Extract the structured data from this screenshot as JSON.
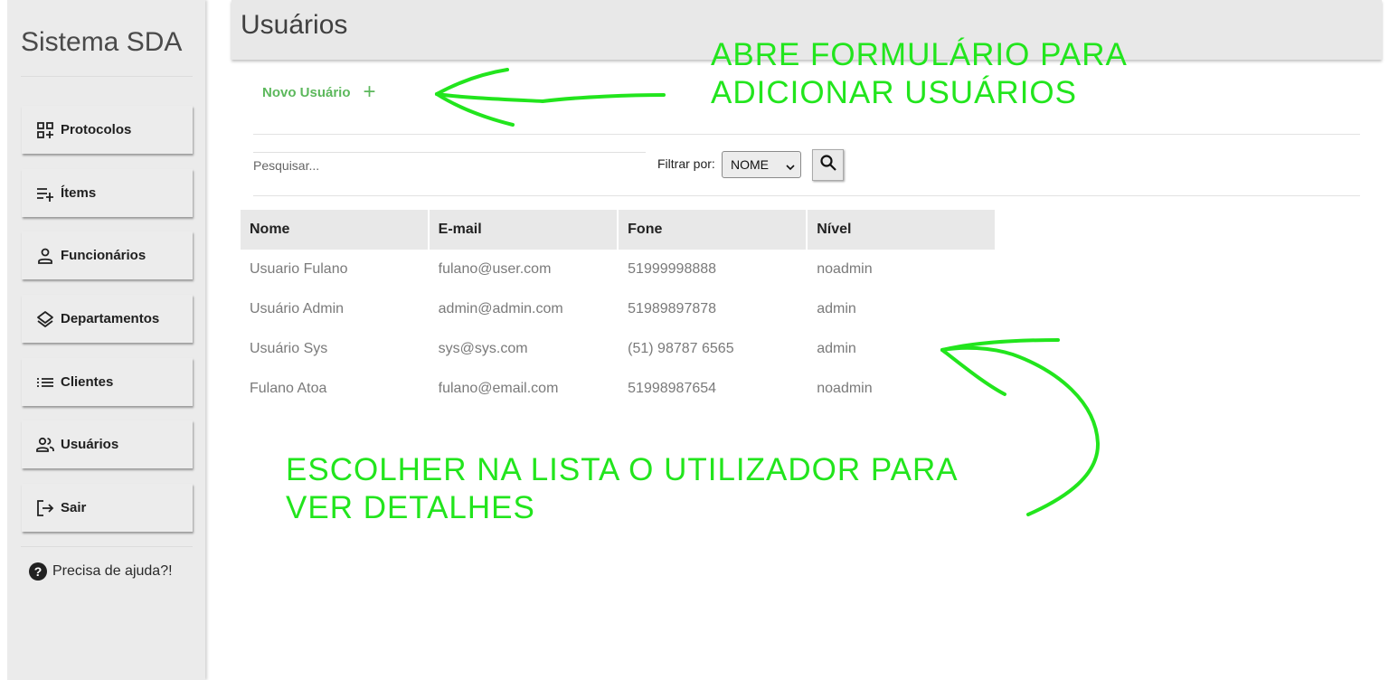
{
  "sidebar": {
    "brand": "Sistema SDA",
    "items": [
      {
        "label": "Protocolos",
        "icon": "grid-plus-icon"
      },
      {
        "label": "Ítems",
        "icon": "playlist-add-icon"
      },
      {
        "label": "Funcionários",
        "icon": "person-icon"
      },
      {
        "label": "Departamentos",
        "icon": "layers-icon"
      },
      {
        "label": "Clientes",
        "icon": "list-icon"
      },
      {
        "label": "Usuários",
        "icon": "group-icon"
      },
      {
        "label": "Sair",
        "icon": "logout-icon"
      }
    ],
    "help": "Precisa de ajuda?!"
  },
  "header": {
    "title": "Usuários"
  },
  "toolbar": {
    "new_user_label": "Novo Usuário",
    "new_user_icon": "+",
    "search_placeholder": "Pesquisar...",
    "filter_label": "Filtrar por:",
    "filter_value": "NOME"
  },
  "table": {
    "columns": [
      "Nome",
      "E-mail",
      "Fone",
      "Nível"
    ],
    "rows": [
      [
        "Usuario Fulano",
        "fulano@user.com",
        "51999998888",
        "noadmin"
      ],
      [
        "Usuário Admin",
        "admin@admin.com",
        "51989897878",
        "admin"
      ],
      [
        "Usuário Sys",
        "sys@sys.com",
        "(51) 98787 6565",
        "admin"
      ],
      [
        "Fulano Atoa",
        "fulano@email.com",
        "51998987654",
        "noadmin"
      ]
    ]
  },
  "annotations": {
    "top_line1": "ABRE FORMULÁRIO PARA",
    "top_line2": "ADICIONAR USUÁRIOS",
    "bottom_line1": "ESCOLHER NA LISTA O UTILIZADOR PARA",
    "bottom_line2": "VER DETALHES"
  },
  "colors": {
    "annotation": "#22e51d",
    "accent": "#5cb85c"
  }
}
